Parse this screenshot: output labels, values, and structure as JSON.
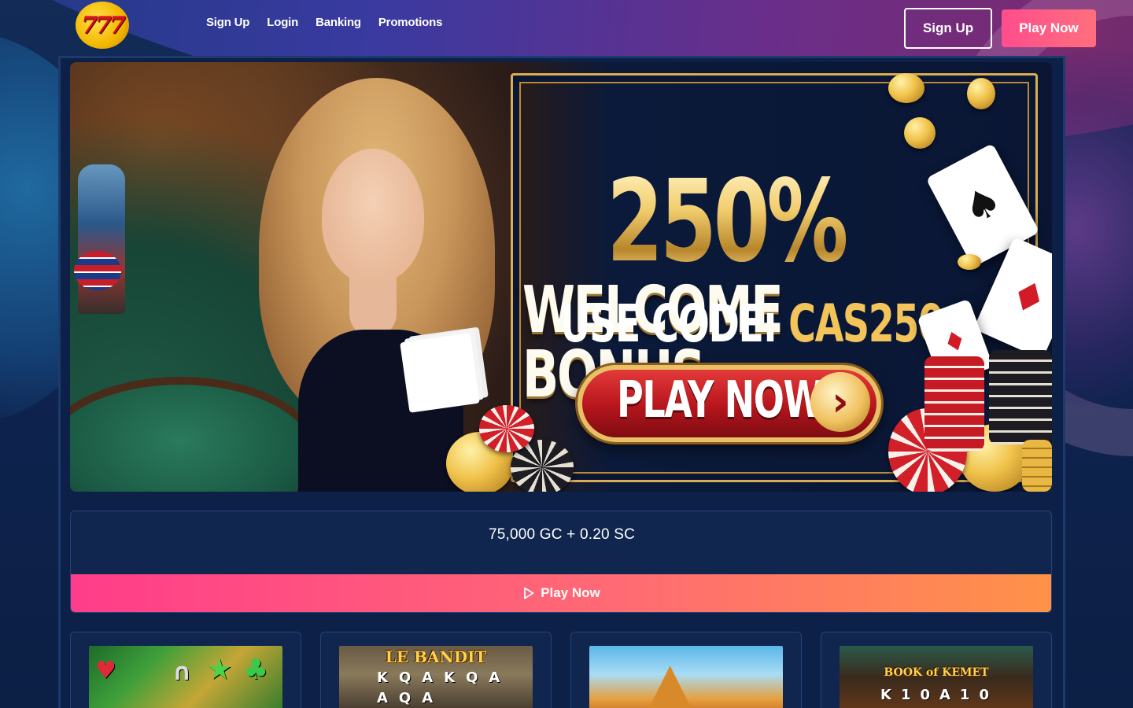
{
  "header": {
    "logo_text": "777",
    "nav": [
      {
        "label": "Sign Up"
      },
      {
        "label": "Login"
      },
      {
        "label": "Banking"
      },
      {
        "label": "Promotions"
      }
    ],
    "signup_button": "Sign Up",
    "play_button": "Play Now"
  },
  "hero": {
    "bonus_percent": "250%",
    "bonus_label": "WELCOME BONUS",
    "code_prefix": "USE CODE:",
    "code": "CAS250",
    "cta": "PLAY NOW",
    "cta_arrow": "›"
  },
  "offer": {
    "amount": "75,000 GC + 0.20 SC",
    "play_button": "Play Now"
  },
  "games": [
    {
      "title": "",
      "icon": "leprechaun-slot"
    },
    {
      "title": "LE BANDIT",
      "icon": "le-bandit-slot"
    },
    {
      "title": "",
      "icon": "ufo-pyramid-slot"
    },
    {
      "title": "BOOK of KEMET",
      "icon": "book-of-kemet-slot"
    }
  ],
  "colors": {
    "accent_pink": "#ff3d8a",
    "accent_orange": "#ff9248",
    "background": "#0d2148",
    "gold": "#f2c45a"
  }
}
